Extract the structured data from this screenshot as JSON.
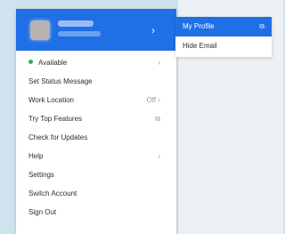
{
  "profile": {
    "chevron_icon": "chevron-right-icon"
  },
  "menu": {
    "items": [
      {
        "label": "Available",
        "right": "›",
        "status_color": "#2fb24c"
      },
      {
        "label": "Set Status Message",
        "right": ""
      },
      {
        "label": "Work Location",
        "right": "Off ›"
      },
      {
        "label": "Try Top Features",
        "right": "⧉"
      },
      {
        "label": "Check for Updates",
        "right": ""
      },
      {
        "label": "Help",
        "right": "›"
      },
      {
        "label": "Settings",
        "right": ""
      },
      {
        "label": "Switch Account",
        "right": ""
      },
      {
        "label": "Sign Out",
        "right": ""
      }
    ]
  },
  "submenu": {
    "items": [
      {
        "label": "My Profile",
        "ext_icon": "⧉"
      },
      {
        "label": "Hide Email"
      }
    ]
  },
  "colors": {
    "accent": "#1f6fe6",
    "status_available": "#2fb24c"
  }
}
